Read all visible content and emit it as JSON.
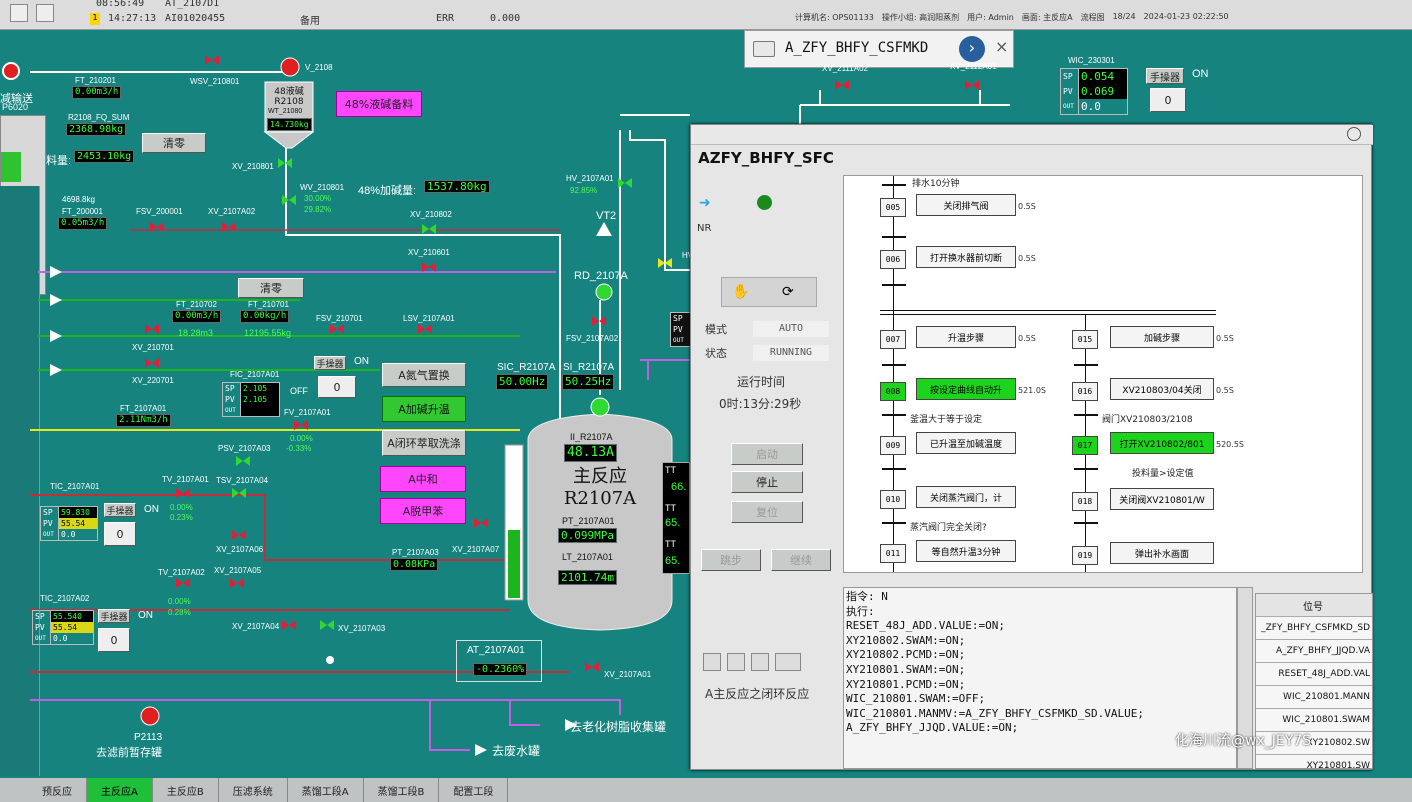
{
  "topbar": {
    "row1_time": "08:56:49",
    "row1_tag": "AT_2107D1",
    "row2_num": "1",
    "row2_time": "14:27:13",
    "row2_tag": "AI01020455",
    "row2_desc": "备用",
    "row2_status": "ERR",
    "row2_value": "0.000",
    "computer": "计算机名: OPS01133",
    "operator_group": "操作小组: 高润阳蒸剂",
    "user": "用户: Admin",
    "screen": "画面: 主反应A",
    "flow": "流程图",
    "page": "18/24",
    "datetime": "2024-01-23 02:22:50"
  },
  "search": {
    "value": "A_ZFY_BHFY_CSFMKD"
  },
  "process": {
    "left_panel": {
      "title": "减输送",
      "pump": "P6020",
      "lbl": "料量:",
      "lbl_val": "2453.10kg"
    },
    "tags": {
      "ft210201": "FT_210201",
      "ft210201_v": "0.00m3/h",
      "wsv210801": "WSV_210801",
      "r2108fq": "R2108_FQ_SUM",
      "r2108fq_v": "2368.98kg",
      "clear1": "清零",
      "v2108": "V_2108",
      "tank2108_l1": "48液碱",
      "tank2108_l2": "R2108",
      "wt21080": "WT_21080",
      "wt21080_v": "14.730kg",
      "prep48": "48%液碱备料",
      "xv210801": "XV_210801",
      "wv210801": "WV_210801",
      "wv210801_v1": "30.00%",
      "wv210801_v2": "29.82%",
      "add48": "48%加碱量:",
      "add48_v": "1537.80kg",
      "v4698": "4698.8kg",
      "ft200001": "FT_200001",
      "ft200001_v": "0.05m3/h",
      "fsv200001": "FSV_200001",
      "xv2107a02": "XV_2107A02",
      "xv210802": "XV_210802",
      "xv210601": "XV_210601",
      "hv2107a01": "HV_2107A01",
      "hv2107a01_v": "92.85%",
      "vt2": "VT2",
      "rd2107a": "RD_2107A",
      "clear2": "清零",
      "ft210702": "FT_210702",
      "ft210702_v": "0.00m3/h",
      "ft210702_v2": "18.28m3",
      "ft210701": "FT_210701",
      "ft210701_v": "0.00kg/h",
      "ft210701_v2": "12195.55kg",
      "fsv210701": "FSV_210701",
      "lsv2107a01": "LSV_2107A01",
      "xv210701": "XV_210701",
      "xv220701": "XV_220701",
      "fsv2107a02": "FSV_2107A02",
      "fic2107a01": "FIC_2107A01",
      "fic_sp": "2.105",
      "fic_pv": "2.105",
      "fic_out": "",
      "manual": "手操器",
      "on": "ON",
      "off": "OFF",
      "zero": "0",
      "ft2107a01": "FT_2107A01",
      "ft2107a01_v": "2.11Nm3/h",
      "fv2107a01": "FV_2107A01",
      "fv2107a01_v1": "0.00%",
      "fv2107a01_v2": "-0.33%",
      "psv2107a03": "PSV_2107A03",
      "tic2107a01": "TIC_2107A01",
      "tic1_sp": "59.830",
      "tic1_pv": "55.54",
      "tic1_out": "0.0",
      "tv2107a01": "TV_2107A01",
      "tv2107a01_v1": "0.00%",
      "tv2107a01_v2": "0.23%",
      "tsv2107a04": "TSV_2107A04",
      "xv2107a06": "XV_2107A06",
      "tic2107a02": "TIC_2107A02",
      "tic2_sp": "55.540",
      "tic2_pv": "55.54",
      "tic2_out": "0.0",
      "tv2107a02": "TV_2107A02",
      "tv2107a02_v1": "0.00%",
      "tv2107a02_v2": "0.28%",
      "xv2107a05": "XV_2107A05",
      "xv2107a04": "XV_2107A04",
      "xv2107a03": "XV_2107A03",
      "pt2107a03": "PT_2107A03",
      "pt2107a03_v": "0.08KPa",
      "xv2107a07": "XV_2107A07",
      "sic": "SIC_R2107A",
      "sic_v": "50.00Hz",
      "si": "SI_R2107A",
      "si_v": "50.25Hz",
      "ii": "II_R2107A",
      "ii_v": "48.13A",
      "reactor_l1": "主反应",
      "reactor_l2": "R2107A",
      "pt2107a01": "PT_2107A01",
      "pt2107a01_v": "0.099MPa",
      "lt2107a01": "LT_2107A01",
      "lt2107a01_v": "2101.74m",
      "at2107a01": "AT_2107A01",
      "at2107a01_v": "-0.2360%",
      "xv2107a01": "XV_2107A01",
      "p2113": "P2113",
      "p2113_desc": "去滤前暂存罐",
      "to_resin": "去老化树脂收集罐",
      "to_waste": "去废水罐",
      "tt1": "TT",
      "tt1_v": "66.",
      "tt2": "TT",
      "tt2_v": "65.",
      "tt3": "TT",
      "tt3_v": "65.",
      "sp": "SP",
      "pv": "PV",
      "out": "OUT",
      "xv2111a02": "XV_2111A02",
      "xv2112a01": "XV_2112A01",
      "wic230301": "WIC_230301",
      "wic_sp": "0.054",
      "wic_pv": "0.069",
      "wic_out": "0.0",
      "wic_manual": "手操器",
      "wic_on": "ON",
      "wic_zero": "0",
      "hv_label": "HV"
    },
    "buttons": {
      "nitrogen": "A氮气置换",
      "alkali_heat": "A加碱升温",
      "closed_extract": "A闭环萃取洗涤",
      "neutralize": "A中和",
      "detoluene": "A脱甲苯"
    }
  },
  "sfc_window": {
    "title": "AZFY_BHFY_SFC",
    "nr": "NR",
    "mode_label": "模式",
    "mode_value": "AUTO",
    "state_label": "状态",
    "state_value": "RUNNING",
    "runtime_label": "运行时间",
    "runtime_value": "0时:13分:29秒",
    "btn_start": "启动",
    "btn_stop": "停止",
    "btn_reset": "复位",
    "btn_jump": "跳步",
    "btn_continue": "继续",
    "desc": "A主反应之闭环反应",
    "steps": {
      "top_cond": "排水10分钟",
      "s005": "005",
      "s005_act": "关闭排气阀",
      "s005_t": "0.5S",
      "s006": "006",
      "s006_act": "打开换水器前切断",
      "s006_t": "0.5S",
      "s007": "007",
      "s007_act": "升温步骤",
      "s007_t": "0.5S",
      "s015": "015",
      "s015_act": "加碱步骤",
      "s015_t": "0.5S",
      "s008": "008",
      "s008_act": "按设定曲线自动升",
      "s008_t": "521.0S",
      "s016": "016",
      "s016_act": "XV210803/04关闭",
      "s016_t": "0.5S",
      "c1": "釜温大于等于设定",
      "c2": "阀门XV210803/2108",
      "s009": "009",
      "s009_act": "已升温至加碱温度",
      "s017": "017",
      "s017_act": "打开XV210802/801",
      "s017_t": "520.5S",
      "c3": "投料量>设定值",
      "s010": "010",
      "s010_act": "关闭蒸汽阀门，计",
      "s018": "018",
      "s018_act": "关闭阀XV210801/W",
      "c4": "蒸汽阀门完全关闭?",
      "s011": "011",
      "s011_act": "等自然升温3分钟",
      "s019": "019",
      "s019_act": "弹出补水画面"
    },
    "commands": [
      "指令: N",
      "执行:",
      "RESET_48J_ADD.VALUE:=ON;",
      "XY210802.SWAM:=ON;",
      "XY210802.PCMD:=ON;",
      "XY210801.SWAM:=ON;",
      "XY210801.PCMD:=ON;",
      "WIC_210801.SWAM:=OFF;",
      "WIC_210801.MANMV:=A_ZFY_BHFY_CSFMKD_SD.VALUE;",
      "A_ZFY_BHFY_JJQD.VALUE:=ON;"
    ],
    "right_list": {
      "header": "位号",
      "items": [
        "_ZFY_BHFY_CSFMKD_SD",
        "A_ZFY_BHFY_JJQD.VA",
        "RESET_48J_ADD.VAL",
        "WIC_210801.MANN",
        "WIC_210801.SWAM",
        "XY210802.SW",
        "XY210801.SW"
      ]
    }
  },
  "nav_tabs": [
    "预反应",
    "主反应A",
    "主反应B",
    "压滤系统",
    "蒸馏工段A",
    "蒸馏工段B",
    "配置工段"
  ],
  "watermark": "化海川流@wx_JEY7S",
  "colors": {
    "background": "#16837f",
    "value_text": "#37ff3b",
    "active_step": "#1dd41d",
    "magenta_button": "#ff46ff",
    "pipe_red": "#c0303a",
    "pipe_purple": "#c060e0"
  }
}
